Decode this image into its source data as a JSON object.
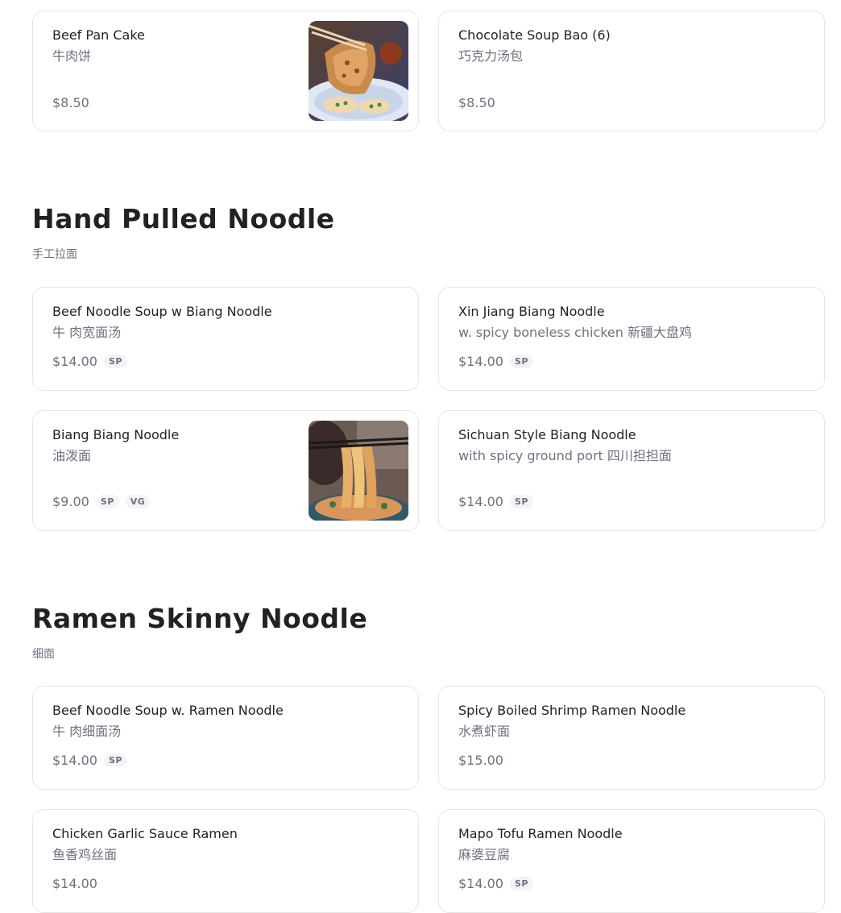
{
  "sections": [
    {
      "title": "",
      "subtitle": "",
      "items": [
        {
          "name": "Beef Pan Cake",
          "desc": "牛肉饼",
          "price": "$8.50",
          "badges": [],
          "image": "beef-pan-cake-photo"
        },
        {
          "name": "Chocolate Soup Bao (6)",
          "desc": "巧克力汤包",
          "price": "$8.50",
          "badges": []
        }
      ]
    },
    {
      "title": "Hand Pulled Noodle",
      "subtitle": "手工拉面",
      "items": [
        {
          "name": "Beef Noodle Soup w Biang Noodle",
          "desc": "牛 肉宽面汤",
          "price": "$14.00",
          "badges": [
            "SP"
          ]
        },
        {
          "name": "Xin Jiang Biang Noodle",
          "desc": "w. spicy boneless chicken 新疆大盘鸡",
          "price": "$14.00",
          "badges": [
            "SP"
          ]
        },
        {
          "name": "Biang Biang Noodle",
          "desc": "油泼面",
          "price": "$9.00",
          "badges": [
            "SP",
            "VG"
          ],
          "image": "biang-noodle-photo"
        },
        {
          "name": "Sichuan Style Biang Noodle",
          "desc": "with spicy ground port 四川担担面",
          "price": "$14.00",
          "badges": [
            "SP"
          ]
        }
      ]
    },
    {
      "title": "Ramen Skinny Noodle",
      "subtitle": "细面",
      "items": [
        {
          "name": "Beef Noodle Soup w. Ramen Noodle",
          "desc": "牛 肉细面汤",
          "price": "$14.00",
          "badges": [
            "SP"
          ]
        },
        {
          "name": "Spicy Boiled Shrimp Ramen Noodle",
          "desc": "水煮虾面",
          "price": "$15.00",
          "badges": []
        },
        {
          "name": "Chicken Garlic Sauce Ramen",
          "desc": "鱼香鸡丝面",
          "price": "$14.00",
          "badges": []
        },
        {
          "name": "Mapo Tofu Ramen Noodle",
          "desc": "麻婆豆腐",
          "price": "$14.00",
          "badges": [
            "SP"
          ]
        }
      ]
    }
  ]
}
